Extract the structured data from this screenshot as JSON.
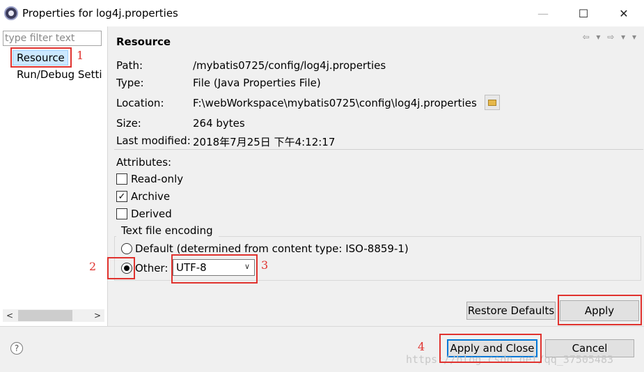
{
  "window": {
    "title": "Properties for log4j.properties",
    "controls": {
      "minimize": "—",
      "maximize": "☐",
      "close": "✕"
    }
  },
  "sidebar": {
    "filter_placeholder": "type filter text",
    "items": [
      {
        "label": "Resource",
        "selected": true
      },
      {
        "label": "Run/Debug Settings",
        "selected": false
      }
    ],
    "scroll_left": "<",
    "scroll_right": ">"
  },
  "main": {
    "section_title": "Resource",
    "nav_arrows": "⇦ ▾ ⇨ ▾ ▾",
    "path_label": "Path:",
    "path_value": "/mybatis0725/config/log4j.properties",
    "type_label": "Type:",
    "type_value": "File  (Java Properties File)",
    "location_label": "Location:",
    "location_value": "F:\\webWorkspace\\mybatis0725\\config\\log4j.properties",
    "size_label": "Size:",
    "size_value": "264  bytes",
    "modified_label": "Last modified:",
    "modified_value": "2018年7月25日 下午4:12:17",
    "attributes_label": "Attributes:",
    "attributes": [
      {
        "label": "Read-only",
        "checked": false
      },
      {
        "label": "Archive",
        "checked": true
      },
      {
        "label": "Derived",
        "checked": false
      }
    ],
    "encoding": {
      "legend": "Text file encoding",
      "default_label": "Default (determined from content type: ISO-8859-1)",
      "other_label": "Other:",
      "selected": "other",
      "other_value": "UTF-8"
    },
    "restore_defaults": "Restore Defaults",
    "apply": "Apply"
  },
  "footer": {
    "help_icon": "?",
    "apply_and_close": "Apply and Close",
    "cancel": "Cancel",
    "watermark": "https://blog.csdn.net/qq_37505483"
  },
  "annotations": {
    "n1": "1",
    "n2": "2",
    "n3": "3",
    "n4": "4",
    "color": "#e0322e"
  }
}
